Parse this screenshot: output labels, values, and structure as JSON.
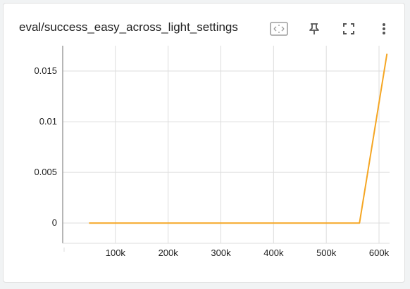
{
  "card": {
    "title": "eval/success_easy_across_light_settings"
  },
  "toolbar": {
    "icons": [
      "fit-domain-icon",
      "pin-icon",
      "fullscreen-icon",
      "more-vert-icon"
    ]
  },
  "colors": {
    "series": "#f5a623",
    "grid": "#dddddd",
    "axis": "#9e9e9e",
    "icon": "#555555"
  },
  "chart_data": {
    "type": "line",
    "title": "eval/success_easy_across_light_settings",
    "xlabel": "",
    "ylabel": "",
    "xlim": [
      0,
      620000
    ],
    "ylim": [
      -0.002,
      0.0175
    ],
    "grid": true,
    "x_ticks": [
      100000,
      200000,
      300000,
      400000,
      500000,
      600000
    ],
    "x_tick_labels": [
      "100k",
      "200k",
      "300k",
      "400k",
      "500k",
      "600k"
    ],
    "y_ticks": [
      0,
      0.005,
      0.01,
      0.015
    ],
    "y_tick_labels": [
      "0",
      "0.005",
      "0.01",
      "0.015"
    ],
    "series": [
      {
        "color": "#f5a623",
        "x": [
          50000,
          563000,
          615000
        ],
        "y": [
          0,
          0,
          0.0167
        ]
      }
    ]
  }
}
